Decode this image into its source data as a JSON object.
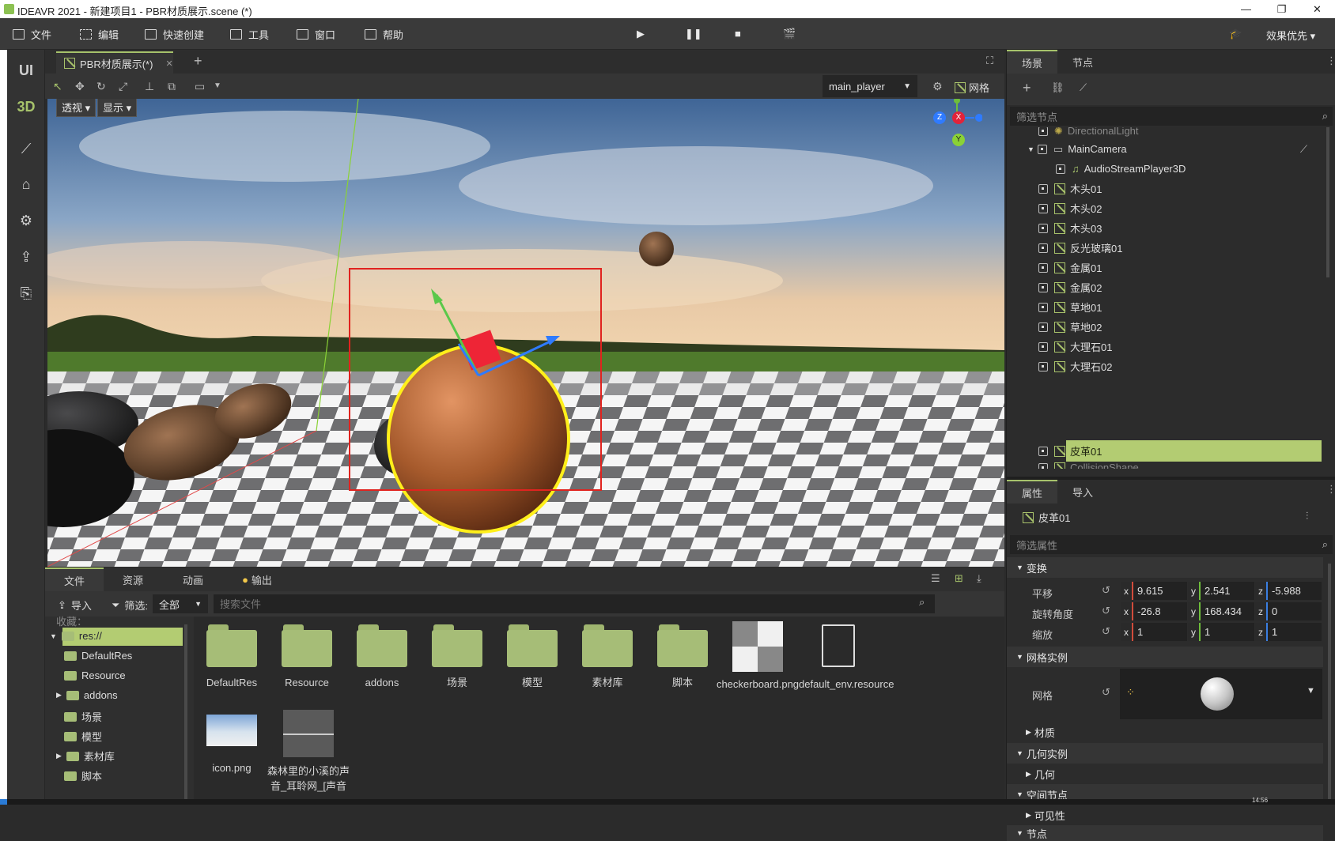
{
  "window": {
    "title": "IDEAVR 2021 - 新建项目1 - PBR材质展示.scene (*)",
    "minimize": "—",
    "maximize": "❐",
    "close": "✕"
  },
  "menu": {
    "file": "文件",
    "edit": "编辑",
    "quick_create": "快速创建",
    "tools": "工具",
    "window": "窗口",
    "help": "帮助",
    "quality": "效果优先"
  },
  "toolcol": {
    "ui": "UI",
    "three_d": "3D"
  },
  "scene_tab": {
    "label": "PBR材质展示(*)",
    "close": "✕",
    "add": "+"
  },
  "viewport_toolbar": {
    "camera": "main_player",
    "grid": "网格"
  },
  "viewport": {
    "perspective": "透视",
    "display": "显示",
    "gizmo_x": "X",
    "gizmo_y": "Y",
    "gizmo_z": "Z"
  },
  "bottom": {
    "tabs": [
      "文件",
      "资源",
      "动画",
      "输出"
    ],
    "import": "导入",
    "filter": "筛选:",
    "filter_value": "全部",
    "search_placeholder": "搜索文件",
    "tree_top": "收藏：",
    "tree": [
      "res://",
      "DefaultRes",
      "Resource",
      "addons",
      "场景",
      "模型",
      "素材库",
      "脚本"
    ],
    "assets": [
      "DefaultRes",
      "Resource",
      "addons",
      "场景",
      "模型",
      "素材库",
      "脚本",
      "checkerboard.png",
      "default_env.resource",
      "icon.png",
      "森林里的小溪的声音_耳聆网_[声音"
    ]
  },
  "scene_panel": {
    "tabs": [
      "场景",
      "节点"
    ],
    "filter_placeholder": "筛选节点",
    "nodes": [
      "DirectionalLight",
      "MainCamera",
      "AudioStreamPlayer3D",
      "木头01",
      "木头02",
      "木头03",
      "反光玻璃01",
      "金属01",
      "金属02",
      "草地01",
      "草地02",
      "大理石01",
      "大理石02",
      "皮革01",
      "CollisionShape"
    ]
  },
  "props_panel": {
    "tabs": [
      "属性",
      "导入"
    ],
    "node_name": "皮革01",
    "filter_placeholder": "筛选属性",
    "transform": "变换",
    "translate": "平移",
    "rotation": "旋转角度",
    "scale": "缩放",
    "translate_vals": [
      "9.615",
      "2.541",
      "-5.988"
    ],
    "rotation_vals": [
      "-26.8",
      "168.434",
      "0"
    ],
    "scale_vals": [
      "1",
      "1",
      "1"
    ],
    "axes": [
      "x",
      "y",
      "z"
    ],
    "mesh_instance": "网格实例",
    "mesh": "网格",
    "material": "材质",
    "geometry_instance": "几何实例",
    "geometry": "几何",
    "spatial_node": "空间节点",
    "visibility": "可见性",
    "node": "节点"
  },
  "status": {
    "time": "14:56"
  },
  "colors": {
    "accent": "#a6c26b",
    "selection": "#b3cc72",
    "bg": "#2b2b2b"
  }
}
